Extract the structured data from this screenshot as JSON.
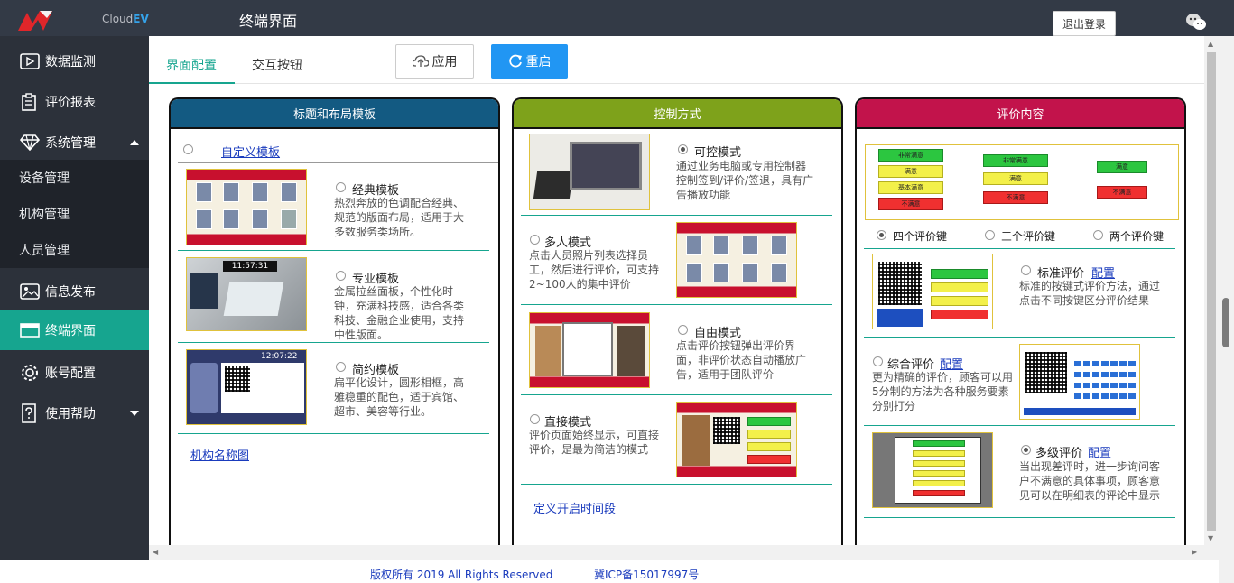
{
  "header": {
    "brand_prefix": "Cloud",
    "brand_suffix": "EV",
    "title": "终端界面",
    "logout_label": "退出登录"
  },
  "sidebar": {
    "items": [
      {
        "label": "数据监测",
        "icon": "play-screen-icon"
      },
      {
        "label": "评价报表",
        "icon": "clipboard-icon"
      },
      {
        "label": "系统管理",
        "icon": "diamond-icon",
        "expanded": true
      },
      {
        "label": "信息发布",
        "icon": "image-icon"
      },
      {
        "label": "终端界面",
        "icon": "window-icon",
        "active": true
      },
      {
        "label": "账号配置",
        "icon": "gear-icon"
      },
      {
        "label": "使用帮助",
        "icon": "help-icon"
      }
    ],
    "sub_items": [
      "设备管理",
      "机构管理",
      "人员管理"
    ]
  },
  "tabs": {
    "active": "界面配置",
    "other": "交互按钮"
  },
  "toolbar": {
    "apply_label": "应用",
    "restart_label": "重启"
  },
  "layout_panel": {
    "title": "标题和布局模板",
    "header_color": "#135a82",
    "custom_template_link": "自定义模板",
    "options": [
      {
        "title": "经典模板",
        "desc": "热烈奔放的色调配合经典、规范的版面布局，适用于大多数服务类场所。"
      },
      {
        "title": "专业模板",
        "desc": "金属拉丝面板，个性化时钟，充满科技感，适合各类科技、金融企业使用，支持中性版面。"
      },
      {
        "title": "简约模板",
        "desc": "扁平化设计，圆形相框，高雅稳重的配色，适于宾馆、超市、美容等行业。"
      }
    ],
    "thumb_clock": "11:57:31",
    "thumb_clock2": "12:07:22",
    "org_name_link": "机构名称图"
  },
  "control_panel": {
    "title": "控制方式",
    "header_color": "#7ea21b",
    "options": [
      {
        "title": "可控模式",
        "desc": "通过业务电脑或专用控制器控制签到/评价/签退，具有广告播放功能",
        "selected": true
      },
      {
        "title": "多人模式",
        "desc": "点击人员照片列表选择员工，然后进行评价，可支持2~100人的集中评价"
      },
      {
        "title": "自由模式",
        "desc": "点击评价按钮弹出评价界面，非评价状态自动播放广告，适用于团队评价"
      },
      {
        "title": "直接模式",
        "desc": "评价页面始终显示，可直接评价，是最为简洁的模式"
      }
    ],
    "time_link": "定义开启时间段"
  },
  "content_panel": {
    "title": "评价内容",
    "header_color": "#c2134b",
    "key_options": [
      "四个评价键",
      "三个评价键",
      "两个评价键"
    ],
    "bar_labels": [
      "非常满意",
      "满意",
      "基本满意",
      "不满意"
    ],
    "config_link": "配置",
    "options": [
      {
        "title": "标准评价",
        "desc": "标准的按键式评价方法，通过点击不同按键区分评价结果"
      },
      {
        "title": "综合评价",
        "desc": "更为精确的评价，顾客可以用5分制的方法为各种服务要素分别打分"
      },
      {
        "title": "多级评价",
        "desc": "当出现差评时，进一步询问客户不满意的具体事项，顾客意见可以在明细表的评论中显示",
        "selected": true
      }
    ]
  },
  "footer": {
    "copyright": "版权所有 2019 All Rights Reserved",
    "icp": "冀ICP备15017997号"
  }
}
